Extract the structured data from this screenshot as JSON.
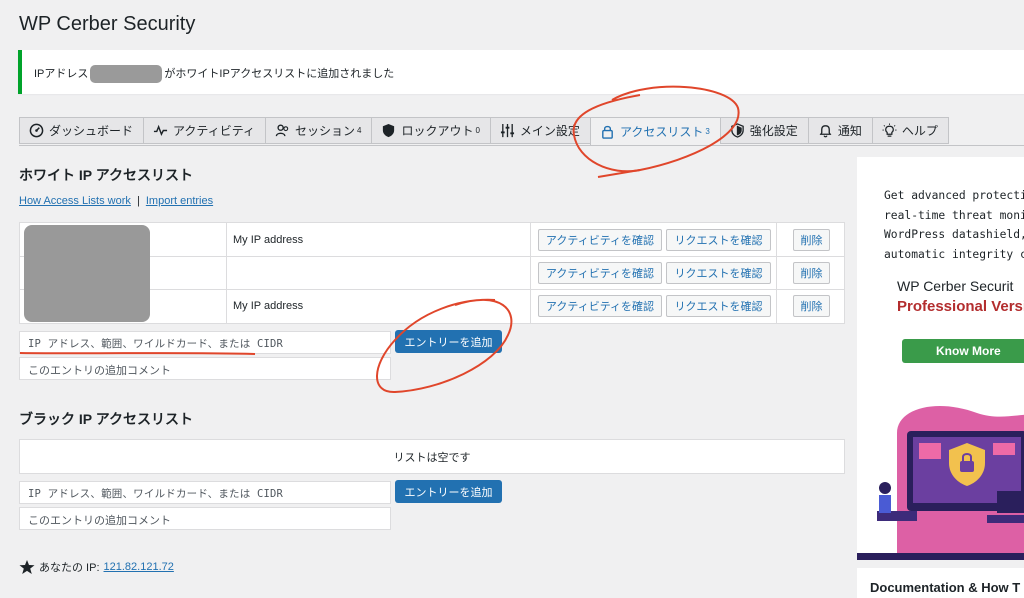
{
  "page": {
    "title": "WP Cerber Security"
  },
  "notice": {
    "prefix": "IPアドレス",
    "suffix": "がホワイトIPアクセスリストに追加されました"
  },
  "tabs": [
    {
      "label": "ダッシュボード",
      "icon": "dashboard-icon",
      "badge": ""
    },
    {
      "label": "アクティビティ",
      "icon": "activity-icon",
      "badge": ""
    },
    {
      "label": "セッション",
      "icon": "users-icon",
      "badge": "4"
    },
    {
      "label": "ロックアウト",
      "icon": "shield-icon",
      "badge": "0"
    },
    {
      "label": "メイン設定",
      "icon": "sliders-icon",
      "badge": ""
    },
    {
      "label": "アクセスリスト",
      "icon": "lock-icon",
      "badge": "3",
      "active": true
    },
    {
      "label": "強化設定",
      "icon": "shield-check-icon",
      "badge": ""
    },
    {
      "label": "通知",
      "icon": "bell-icon",
      "badge": ""
    },
    {
      "label": "ヘルプ",
      "icon": "lightbulb-icon",
      "badge": ""
    }
  ],
  "whitelist": {
    "title": "ホワイト IP アクセスリスト",
    "link_how": "How Access Lists work",
    "link_sep": "|",
    "link_import": "Import entries",
    "rows": [
      {
        "label": "My IP address"
      },
      {
        "label": ""
      },
      {
        "label": "My IP address"
      }
    ],
    "btn_activity": "アクティビティを確認",
    "btn_requests": "リクエストを確認",
    "btn_delete": "削除",
    "input_placeholder": "IP アドレス、範囲、ワイルドカード、または CIDR",
    "comment_placeholder": "このエントリの追加コメント",
    "add_button": "エントリーを追加"
  },
  "blacklist": {
    "title": "ブラック IP アクセスリスト",
    "empty": "リストは空です",
    "input_placeholder": "IP アドレス、範囲、ワイルドカード、または CIDR",
    "comment_placeholder": "このエントリの追加コメント",
    "add_button": "エントリーを追加"
  },
  "your_ip": {
    "label": "あなたの IP:",
    "value": "121.82.121.72"
  },
  "sidebar": {
    "promo_lines": [
      "Get advanced protection",
      "real-time threat monitor",
      "WordPress datashield, ar",
      "automatic integrity check"
    ],
    "brand": "WP Cerber Securit",
    "edition": "Professional Versio",
    "cta": "Know More",
    "docs_title": "Documentation & How T"
  },
  "colors": {
    "accent": "#2271b1",
    "success": "#00a32a",
    "annotation": "#e0462b",
    "pro_red": "#b32d2e",
    "cta_green": "#3a9b4a"
  }
}
